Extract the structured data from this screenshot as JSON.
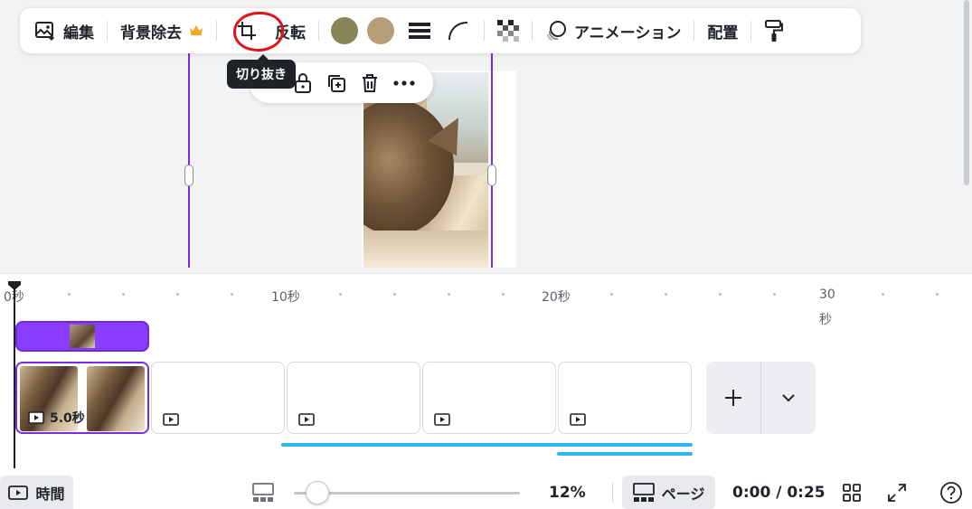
{
  "toolbar": {
    "edit_label": "編集",
    "bg_remove_label": "背景除去",
    "flip_label": "反転",
    "animation_label": "アニメーション",
    "position_label": "配置",
    "colors": [
      "#878657",
      "#b79c78"
    ]
  },
  "tooltip": {
    "crop_label": "切り抜き"
  },
  "timeline": {
    "ruler": [
      "0秒",
      "10秒",
      "20秒",
      "30",
      "秒"
    ],
    "active_clip_duration": "5.0秒"
  },
  "bottom": {
    "time_label": "時間",
    "zoom": "12%",
    "page_label": "ページ",
    "playback_time": "0:00 / 0:25",
    "zoom_level_fraction": 0.1
  },
  "accent": {
    "selection": "#7d2ae8",
    "crop_mark": "#e0141b",
    "progress": "#2fb8ed"
  }
}
